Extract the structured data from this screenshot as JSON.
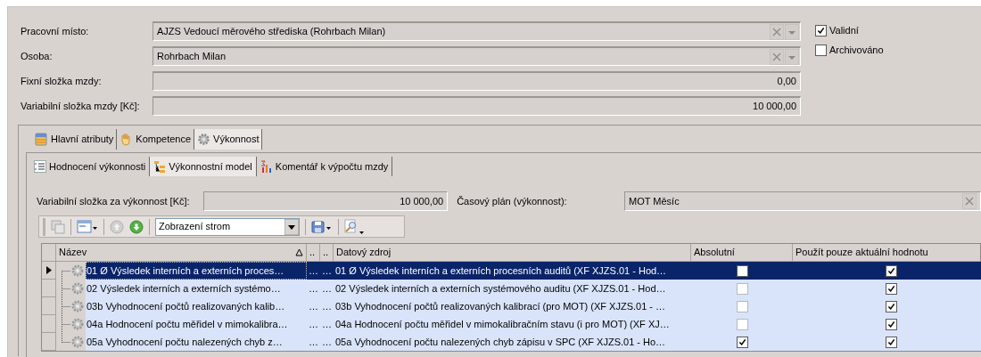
{
  "form": {
    "fields": [
      {
        "label": "Pracovní místo:",
        "value": "AJZS Vedoucí měrového střediska (Rohrbach Milan)",
        "kind": "lookup"
      },
      {
        "label": "Osoba:",
        "value": "Rohrbach Milan",
        "kind": "lookup"
      },
      {
        "label": "Fixní složka mzdy:",
        "value": "0,00",
        "kind": "number"
      },
      {
        "label": "Variabilní složka mzdy [Kč]:",
        "value": "10 000,00",
        "kind": "number"
      }
    ],
    "checkboxes": [
      {
        "label": "Validní",
        "checked": true
      },
      {
        "label": "Archivováno",
        "checked": false
      }
    ]
  },
  "tabs": [
    {
      "label": "Hlavní atributy",
      "selected": false
    },
    {
      "label": "Kompetence",
      "selected": false
    },
    {
      "label": "Výkonnost",
      "selected": true
    }
  ],
  "subtabs": [
    {
      "label": "Hodnocení výkonnosti",
      "selected": false
    },
    {
      "label": "Výkonnostní model",
      "selected": true
    },
    {
      "label": "Komentář k výpočtu mzdy",
      "selected": false
    }
  ],
  "performance": {
    "amount_label": "Variabilní složka za výkonnost [Kč]:",
    "amount_value": "10 000,00",
    "plan_label": "Časový plán (výkonnost):",
    "plan_value": "MOT Měsíc"
  },
  "toolbar": {
    "view_select": "Zobrazení strom"
  },
  "table": {
    "columns": [
      "Název",
      "..",
      "..",
      "Datový zdroj",
      "Absolutní",
      "Použít pouze aktuální hodnotu"
    ],
    "rows": [
      {
        "name": "01 Ø Výsledek interních a externích proces…",
        "column_2": "…",
        "column_3": "…",
        "source": "01 Ø Výsledek interních a externích procesních auditů (XF XJZS.01 - Hod…",
        "absolute": false,
        "current_only": true,
        "selected": true
      },
      {
        "name": "02 Výsledek interních a externích systémo…",
        "column_2": "…",
        "column_3": "…",
        "source": "02 Výsledek interních a externích systémového auditu (XF XJZS.01 - Hod…",
        "absolute": false,
        "current_only": true,
        "selected": false
      },
      {
        "name": "03b Vyhodnocení počtů realizovaných kalib…",
        "column_2": "…",
        "column_3": "…",
        "source": "03b Vyhodnocení počtů realizovaných kalibrací  (pro MOT) (XF XJZS.01 - …",
        "absolute": false,
        "current_only": true,
        "selected": false
      },
      {
        "name": "04a Hodnocení počtu měřidel v mimokalibra…",
        "column_2": "…",
        "column_3": "…",
        "source": "04a Hodnocení počtu měřidel v mimokalibračním stavu (i pro MOT) (XF XJ…",
        "absolute": false,
        "current_only": true,
        "selected": false
      },
      {
        "name": "05a Vyhodnocení počtu nalezených chyb z…",
        "column_2": "…",
        "column_3": "…",
        "source": "05a Vyhodnocení počtu nalezených chyb zápisu v SPC (XF XJZS.01 - Ho…",
        "absolute": true,
        "current_only": true,
        "selected": false
      }
    ]
  }
}
